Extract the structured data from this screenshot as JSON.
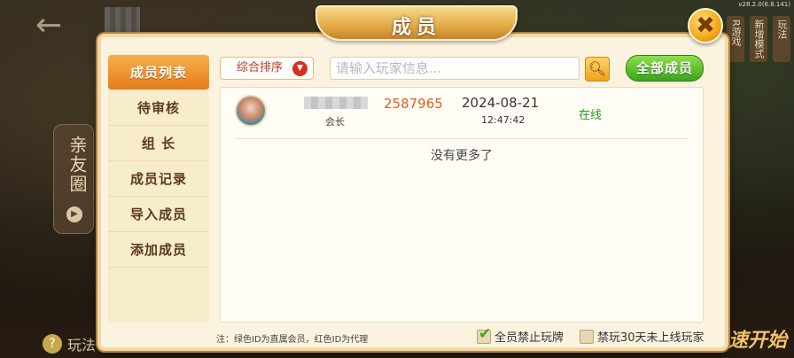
{
  "background": {
    "version": "v28.2.0(6.8.141)",
    "side_panel_label": "亲友圈",
    "bottom_left_label": "玩法",
    "quick_start": "速开始",
    "right_tags": [
      "R游戏",
      "新增模式",
      "玩法"
    ]
  },
  "dialog": {
    "title": "成员",
    "close_icon": "close-hammer-icon"
  },
  "sidebar": {
    "items": [
      {
        "label": "成员列表",
        "active": true
      },
      {
        "label": "待审核",
        "active": false
      },
      {
        "label": "组 长",
        "active": false
      },
      {
        "label": "成员记录",
        "active": false
      },
      {
        "label": "导入成员",
        "active": false
      },
      {
        "label": "添加成员",
        "active": false
      }
    ]
  },
  "toolbar": {
    "sort_label": "综合排序",
    "search_placeholder": "请输入玩家信息...",
    "search_icon": "magnifier-icon",
    "all_members_label": "全部成员"
  },
  "members": [
    {
      "name": "",
      "role": "会长",
      "id": "2587965",
      "date": "2024-08-21",
      "time": "12:47:42",
      "status": "在线"
    }
  ],
  "list_end_text": "没有更多了",
  "footer": {
    "note": "注：绿色ID为直属会员，红色ID为代理",
    "option1": {
      "label": "全员禁止玩牌",
      "checked": true
    },
    "option2": {
      "label": "禁玩30天未上线玩家",
      "checked": false
    }
  },
  "colors": {
    "accent_orange": "#e57d1a",
    "green_button": "#39a51a",
    "member_id_color": "#e0601a",
    "online_color": "#2a9a1a"
  }
}
